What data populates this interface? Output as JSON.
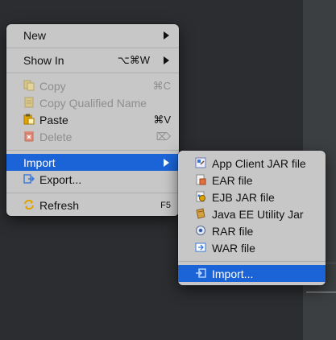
{
  "context_menu": {
    "new": {
      "label": "New"
    },
    "show_in": {
      "label": "Show In",
      "shortcut": "⌥⌘W"
    },
    "copy": {
      "label": "Copy",
      "shortcut": "⌘C"
    },
    "copy_qualified_name": {
      "label": "Copy Qualified Name"
    },
    "paste": {
      "label": "Paste",
      "shortcut": "⌘V"
    },
    "delete": {
      "label": "Delete",
      "shortcut": "⌦"
    },
    "import": {
      "label": "Import"
    },
    "export": {
      "label": "Export..."
    },
    "refresh": {
      "label": "Refresh",
      "shortcut": "F5"
    }
  },
  "import_submenu": {
    "items": [
      {
        "label": "App Client JAR file",
        "icon": "app-client-jar-icon"
      },
      {
        "label": "EAR file",
        "icon": "ear-file-icon"
      },
      {
        "label": "EJB JAR file",
        "icon": "ejb-jar-icon"
      },
      {
        "label": "Java EE Utility Jar",
        "icon": "java-ee-utility-jar-icon"
      },
      {
        "label": "RAR file",
        "icon": "rar-file-icon"
      },
      {
        "label": "WAR file",
        "icon": "war-file-icon"
      }
    ],
    "import_more": {
      "label": "Import..."
    }
  },
  "colors": {
    "menu_bg": "#c7c7c7",
    "selection": "#1b64d8",
    "disabled_text": "#8e8e8e",
    "background": "#2b2d30"
  }
}
